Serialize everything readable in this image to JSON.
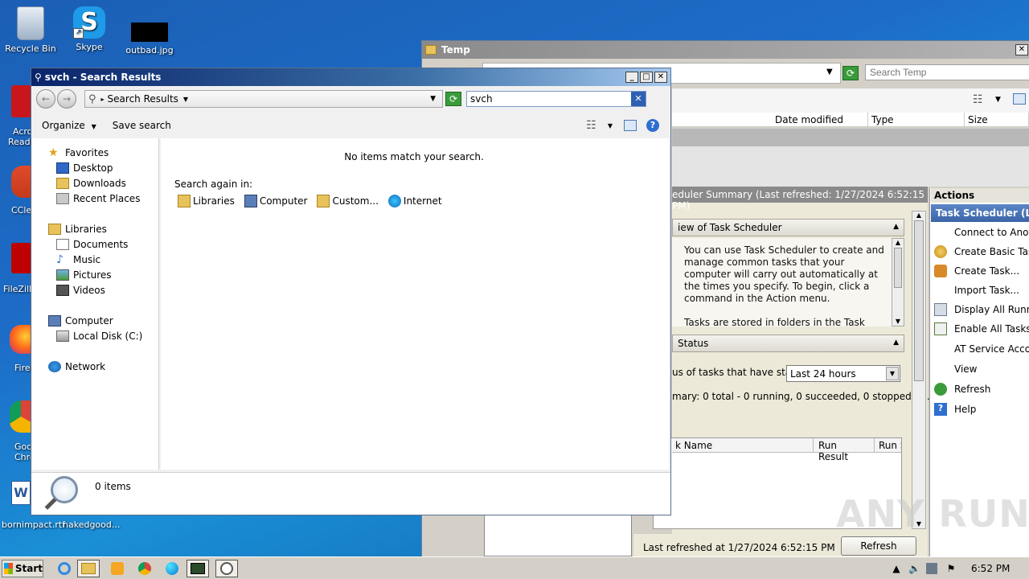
{
  "desktop": {
    "icons": [
      {
        "label": "Recycle Bin"
      },
      {
        "label": "Skype"
      },
      {
        "label": "outbad.jpg"
      }
    ],
    "partial_labels": [
      "Acro",
      "Read",
      "CCle",
      "FileZilla",
      "Fire",
      "Goo",
      "Chro",
      "bornimpact.rtf",
      "nakedgood..."
    ]
  },
  "temp_window": {
    "title": "Temp",
    "search_placeholder": "Search Temp",
    "columns": [
      "Date modified",
      "Type",
      "Size"
    ]
  },
  "task_scheduler": {
    "summary_header": "eduler Summary (Last refreshed: 1/27/2024 6:52:15 PM)",
    "overview_header": "iew of Task Scheduler",
    "overview_text": "You can use Task Scheduler to create and manage common tasks that your computer will carry out automatically at the times you specify. To begin, click a command in the Action menu.",
    "overview_text2": "Tasks are stored in folders in the Task",
    "status_header": "Status",
    "status_label": "us of tasks that have sta...",
    "status_select": "Last 24 hours",
    "summary_line": "mary: 0 total - 0 running, 0 succeeded, 0 stopped, 0...",
    "table_columns": [
      "k Name",
      "Run Result",
      "Run S"
    ],
    "last_refreshed": "Last refreshed at 1/27/2024 6:52:15 PM",
    "refresh_button": "Refresh",
    "actions_header": "Actions",
    "actions_subheader": "Task Scheduler (Loca",
    "actions": [
      {
        "label": "Connect to Another",
        "icon": "blank"
      },
      {
        "label": "Create Basic Task...",
        "icon": "wizard"
      },
      {
        "label": "Create Task...",
        "icon": "task"
      },
      {
        "label": "Import Task...",
        "icon": "blank"
      },
      {
        "label": "Display All Running",
        "icon": "list"
      },
      {
        "label": "Enable All Tasks His",
        "icon": "history"
      },
      {
        "label": "AT Service Account",
        "icon": "blank"
      },
      {
        "label": "View",
        "icon": "blank"
      },
      {
        "label": "Refresh",
        "icon": "refresh"
      },
      {
        "label": "Help",
        "icon": "help"
      }
    ]
  },
  "search_window": {
    "title": "svch - Search Results",
    "breadcrumb": "Search Results",
    "search_value": "svch",
    "toolbar": {
      "organize": "Organize",
      "save_search": "Save search"
    },
    "nav": {
      "favorites": "Favorites",
      "favorites_items": [
        "Desktop",
        "Downloads",
        "Recent Places"
      ],
      "libraries": "Libraries",
      "libraries_items": [
        "Documents",
        "Music",
        "Pictures",
        "Videos"
      ],
      "computer": "Computer",
      "computer_items": [
        "Local Disk (C:)"
      ],
      "network": "Network"
    },
    "no_items": "No items match your search.",
    "search_again": "Search again in:",
    "locations": [
      "Libraries",
      "Computer",
      "Custom...",
      "Internet"
    ],
    "status": "0 items"
  },
  "taskbar": {
    "start": "Start",
    "clock": "6:52 PM"
  },
  "watermark": "ANY RUN"
}
